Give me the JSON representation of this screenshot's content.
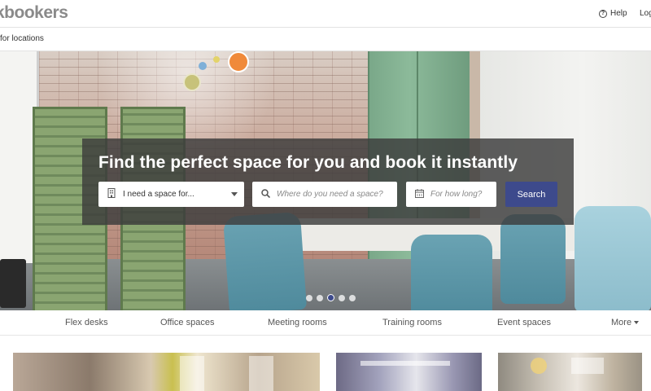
{
  "header": {
    "logo": "kbookers",
    "help_label": "Help",
    "login_label": "Log"
  },
  "subbar": {
    "text": "for locations"
  },
  "hero": {
    "title": "Find the perfect space for you and book it instantly",
    "space_type_value": "I need a space for...",
    "where_placeholder": "Where do you need a space?",
    "duration_placeholder": "For how long?",
    "search_label": "Search",
    "carousel_dots": 5,
    "active_dot": 3,
    "accent_color": "#3d4a8c"
  },
  "icons": {
    "help": "help-circle-icon",
    "space_type": "building-icon",
    "where": "search-icon",
    "duration": "calendar-icon"
  },
  "categories": [
    {
      "label": "Flex desks"
    },
    {
      "label": "Office spaces"
    },
    {
      "label": "Meeting rooms"
    },
    {
      "label": "Training rooms"
    },
    {
      "label": "Event spaces"
    },
    {
      "label": "More"
    }
  ]
}
